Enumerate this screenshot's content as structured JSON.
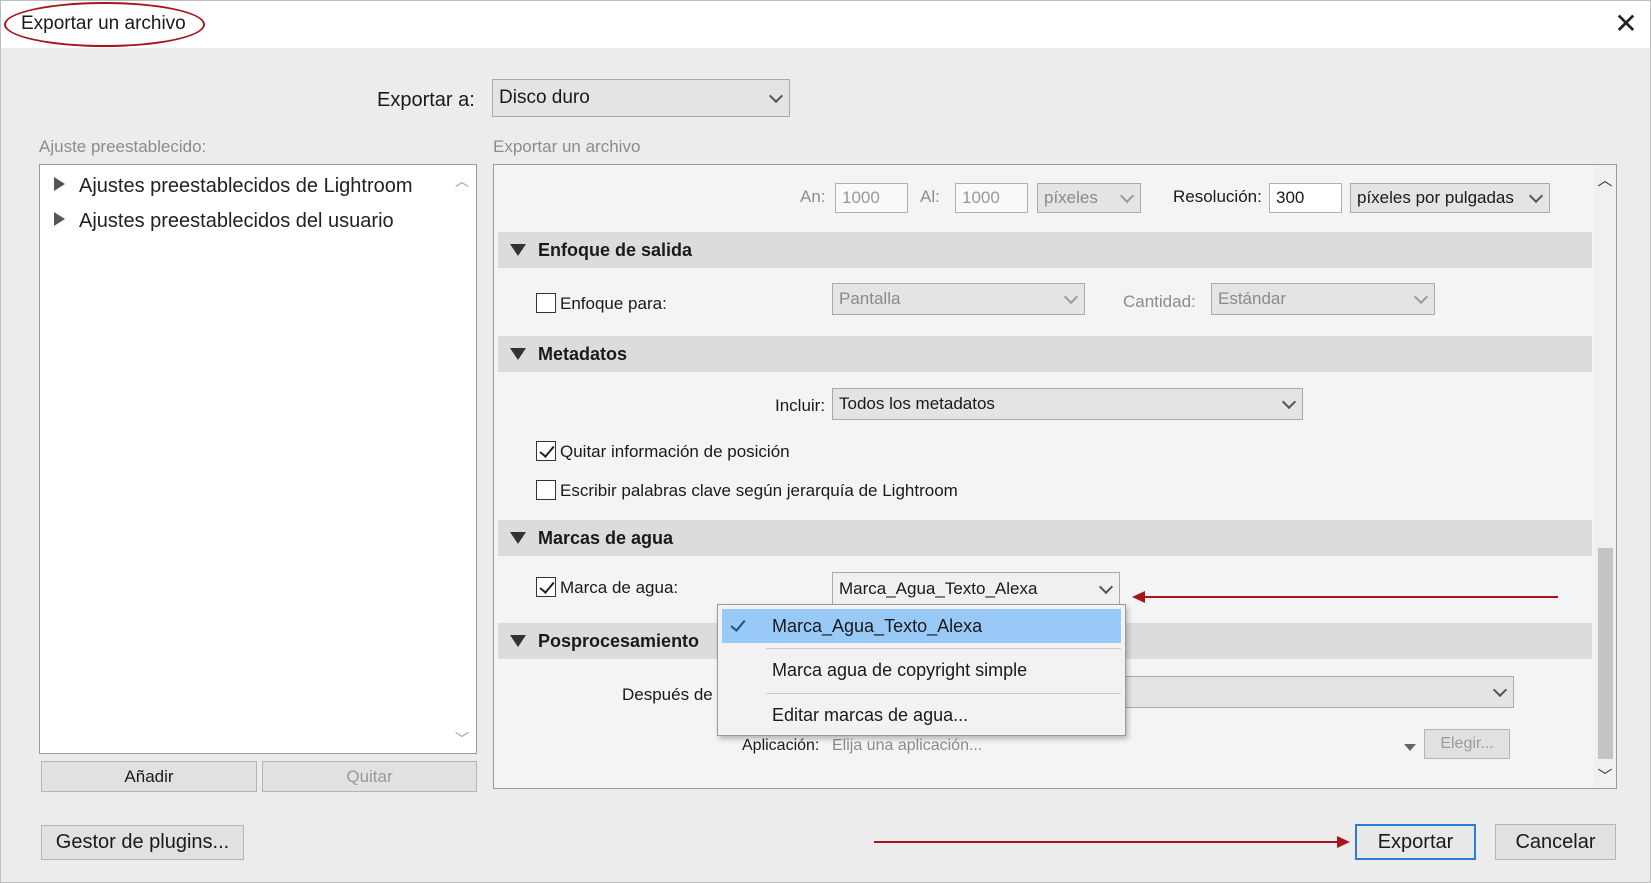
{
  "window": {
    "title": "Exportar un archivo",
    "close_icon": "close-icon"
  },
  "export_to": {
    "label": "Exportar a:",
    "value": "Disco duro"
  },
  "presets": {
    "label": "Ajuste preestablecido:",
    "items": [
      "Ajustes preestablecidos de Lightroom",
      "Ajustes preestablecidos del usuario"
    ],
    "add_button": "Añadir",
    "remove_button": "Quitar"
  },
  "settings": {
    "label": "Exportar un archivo",
    "size": {
      "width_label": "An:",
      "width_value": "1000",
      "height_label": "Al:",
      "height_value": "1000",
      "units": "píxeles",
      "resolution_label": "Resolución:",
      "resolution_value": "300",
      "resolution_units": "píxeles por pulgadas"
    },
    "sharpening": {
      "header": "Enfoque de salida",
      "sharpen_label": "Enfoque para:",
      "sharpen_checked": false,
      "sharpen_for": "Pantalla",
      "amount_label": "Cantidad:",
      "amount_value": "Estándar"
    },
    "metadata": {
      "header": "Metadatos",
      "include_label": "Incluir:",
      "include_value": "Todos los metadatos",
      "remove_location_label": "Quitar información de posición",
      "remove_location_checked": true,
      "keywords_label": "Escribir palabras clave según jerarquía de Lightroom",
      "keywords_checked": false
    },
    "watermark": {
      "header": "Marcas de agua",
      "label": "Marca de agua:",
      "checked": true,
      "value": "Marca_Agua_Texto_Alexa",
      "options": [
        "Marca_Agua_Texto_Alexa",
        "Marca agua de copyright simple",
        "Editar marcas de agua..."
      ]
    },
    "postprocessing": {
      "header": "Posprocesamiento",
      "after_label": "Después de l",
      "app_label": "Aplicación:",
      "app_placeholder": "Elija una aplicación...",
      "choose_button": "Elegir..."
    }
  },
  "footer": {
    "plugin_manager": "Gestor de plugins...",
    "export": "Exportar",
    "cancel": "Cancelar"
  },
  "colors": {
    "annotation": "#a4161a",
    "selection": "#99c9f7",
    "primary_border": "#2d7bd6"
  }
}
